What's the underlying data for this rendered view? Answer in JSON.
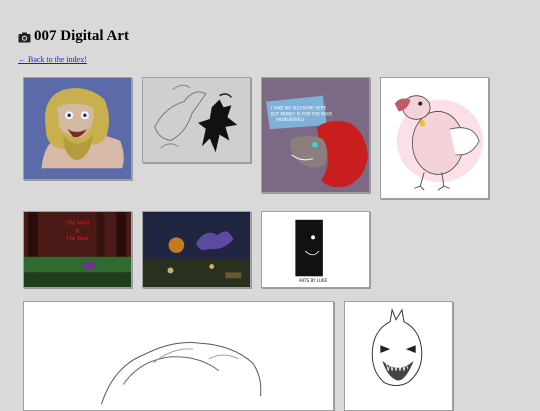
{
  "page": {
    "title": "007 Digital Art",
    "back_link": "← Back to the index!"
  },
  "icons": {
    "title_icon": "camera-icon"
  },
  "gallery": {
    "items": [
      {
        "name": "gallery-image-bearded-figure"
      },
      {
        "name": "gallery-image-creature-sketch"
      },
      {
        "name": "gallery-image-wolf-speech",
        "speech": [
          "I TAKE NO PLEASURE HERE.",
          "BUT MONEY IS FOR THE NAVE.",
          "(HUNGERING)"
        ]
      },
      {
        "name": "gallery-image-pink-bird"
      },
      {
        "name": "gallery-image-wolf-and-bear",
        "title_lines": [
          "The Wolf",
          "&",
          "The Bear"
        ]
      },
      {
        "name": "gallery-image-night-scene"
      },
      {
        "name": "gallery-image-dark-figure",
        "caption": "ARTS BY LUKE"
      },
      {
        "name": "gallery-image-line-sketch"
      },
      {
        "name": "gallery-image-monster-sketch"
      }
    ]
  },
  "colors": {
    "page_bg": "#d9d9d9",
    "link": "#1a1aee",
    "thumb_border": "#a0a0a0"
  }
}
